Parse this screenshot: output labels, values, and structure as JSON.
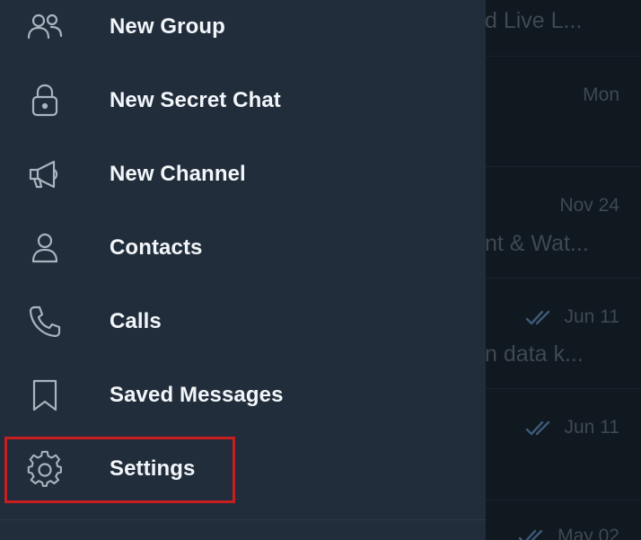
{
  "menu": {
    "items": [
      {
        "label": "New Group",
        "icon": "group-icon"
      },
      {
        "label": "New Secret Chat",
        "icon": "lock-icon"
      },
      {
        "label": "New Channel",
        "icon": "megaphone-icon"
      },
      {
        "label": "Contacts",
        "icon": "contact-icon"
      },
      {
        "label": "Calls",
        "icon": "phone-icon"
      },
      {
        "label": "Saved Messages",
        "icon": "bookmark-icon"
      },
      {
        "label": "Settings",
        "icon": "gear-icon"
      }
    ]
  },
  "chats": {
    "rows": [
      {
        "date": "",
        "snippet": "d Live L..."
      },
      {
        "date": "Mon",
        "snippet": ""
      },
      {
        "date": "Nov 24",
        "snippet": "nt & Wat..."
      },
      {
        "date": "Jun 11",
        "snippet": "n data k..."
      },
      {
        "date": "Jun 11",
        "snippet": ""
      },
      {
        "date": "May 02",
        "snippet": ""
      }
    ]
  },
  "colors": {
    "drawer_bg": "#212d3b",
    "chat_bg": "#101820",
    "label_text": "#f3f6f9",
    "icon_stroke": "#aab4bf",
    "highlight": "#c81e1e",
    "dim_text": "#3f4953",
    "read_tick": "#3d5a78"
  }
}
